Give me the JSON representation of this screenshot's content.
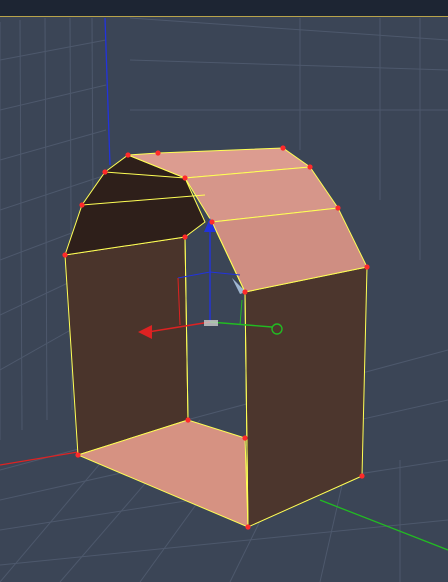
{
  "app": {
    "viewport_label": "",
    "background_color": "#3b4556",
    "grid_color": "#4f5a6d"
  },
  "scene": {
    "object": "arch-mesh",
    "selection_color": "#ffff55",
    "vertex_color": "#ff2a2a",
    "face_light": "#d9968a",
    "face_dark": "#4a3329",
    "axis_colors": {
      "x": "#dd2222",
      "y": "#22bb22",
      "z": "#2233dd"
    }
  }
}
